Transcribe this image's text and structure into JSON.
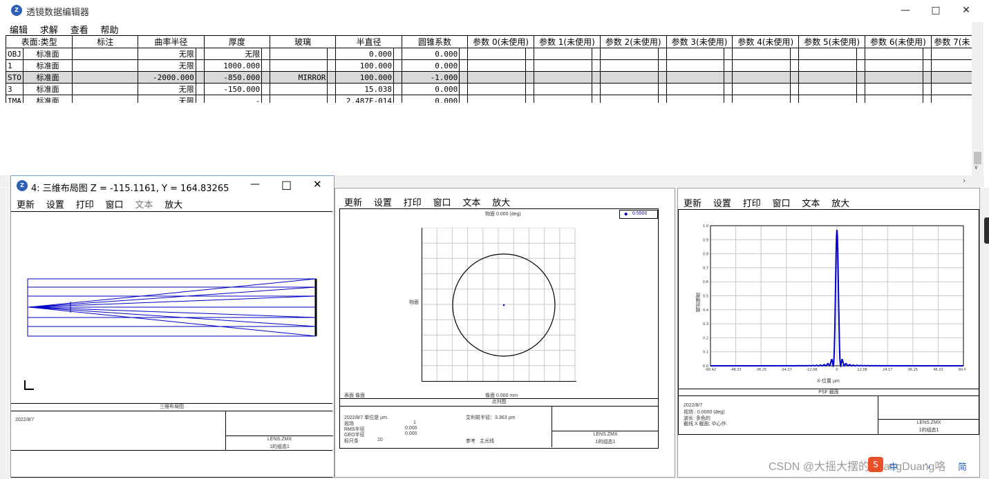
{
  "main_window": {
    "title": "透镜数据编辑器",
    "icon_text": "Z",
    "menu": [
      "编辑",
      "求解",
      "查看",
      "帮助"
    ],
    "columns": [
      "表面:类型",
      "",
      "标注",
      "",
      "曲率半径",
      "",
      "厚度",
      "",
      "玻璃",
      "",
      "半直径",
      "",
      "圆锥系数",
      "",
      "参数 0(未使用)",
      "",
      "参数 1(未使用)",
      "",
      "参数 2(未使用)",
      "",
      "参数 3(未使用)",
      "",
      "参数 4(未使用)",
      "",
      "参数 5(未使用)",
      "",
      "参数 6(未使用)",
      "",
      "参数 7(未"
    ],
    "rows": [
      {
        "surf": "OBJ",
        "type": "标准面",
        "comment": "",
        "radius": "无限",
        "thickness": "无限",
        "glass": "",
        "semi_dia": "0.000",
        "conic": "0.000"
      },
      {
        "surf": "1",
        "type": "标准面",
        "comment": "",
        "radius": "无限",
        "thickness": "1000.000",
        "glass": "",
        "semi_dia": "100.000",
        "conic": "0.000"
      },
      {
        "surf": "STO",
        "type": "标准面",
        "comment": "",
        "radius": "-2000.000",
        "thickness": "-850.000",
        "glass": "MIRROR",
        "semi_dia": "100.000",
        "conic": "-1.000"
      },
      {
        "surf": "3",
        "type": "标准面",
        "comment": "",
        "radius": "无限",
        "thickness": "-150.000",
        "glass": "",
        "semi_dia": "15.038",
        "conic": "0.000"
      },
      {
        "surf": "IMA",
        "type": "标准面",
        "comment": "",
        "radius": "无限",
        "thickness": "-",
        "glass": "",
        "semi_dia": "2.487E-014",
        "conic": "0.000"
      }
    ]
  },
  "layout_window": {
    "title": "4: 三维布局图 Z = -115.1161, Y = 164.83265",
    "menu": [
      "更新",
      "设置",
      "打印",
      "窗口",
      "文本",
      "放大"
    ],
    "footer_title": "三维布局图",
    "date": "2022/8/7",
    "file": "LENS.ZMX",
    "config": "1的组态1"
  },
  "spot_window": {
    "menu": [
      "更新",
      "设置",
      "打印",
      "窗口",
      "文本",
      "放大"
    ],
    "top_label": "物面 0.000 (deg)",
    "legend": "0.5500",
    "ylabel": "物面",
    "bottom_left": "表面 像面",
    "bottom_center": "像面 0.000 mm",
    "footer_title": "点列图",
    "date": "2022/8/7  单位是 µm.",
    "airy": "艾利斑半径：3.363 µm",
    "field_label": "视场",
    "field_value": "1",
    "rms_label": "RMS半径",
    "rms_value": "0.000",
    "geo_label": "GEO半径",
    "geo_value": "0.000",
    "scale_label": "标尺条",
    "scale_value": "10",
    "ref_label": "参考",
    "ref_value": "主光线",
    "file": "LENS.ZMX",
    "config": "1的组态1"
  },
  "psf_window": {
    "menu": [
      "更新",
      "设置",
      "打印",
      "窗口",
      "文本",
      "放大"
    ],
    "xlabel": "X-位置 µm",
    "ylabel": "相对强度",
    "yticks": [
      "1.0",
      "0.9",
      "0.8",
      "0.7",
      "0.6",
      "0.5",
      "0.4",
      "0.3",
      "0.2",
      "0.1",
      "0.0"
    ],
    "xticks": [
      "-60.42",
      "-48.33",
      "-36.25",
      "-24.17",
      "-12.08",
      "0",
      "12.08",
      "24.17",
      "36.25",
      "48.33",
      "60.42"
    ],
    "footer_title": "PSF 截面",
    "date": "2022/8/7",
    "field_line": "视场       : 0.0000 (deg)",
    "type_line": "波长: 多色的",
    "center_line": "截线 X 截面; 中心作.",
    "file": "LENS.ZMX",
    "config": "1的组态1"
  },
  "watermark": "CSDN @大摇大摆的DuangDuang咯",
  "tray": [
    "中",
    "·,",
    "简"
  ],
  "colors": {
    "line_blue": "#0000c8",
    "selected_row": "#d9d9d9"
  }
}
